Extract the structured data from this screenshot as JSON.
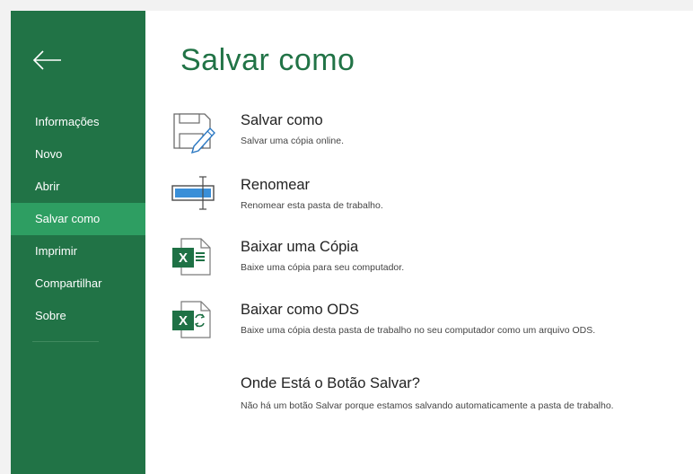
{
  "sidebar": {
    "items": [
      {
        "label": "Informações"
      },
      {
        "label": "Novo"
      },
      {
        "label": "Abrir"
      },
      {
        "label": "Salvar como"
      },
      {
        "label": "Imprimir"
      },
      {
        "label": "Compartilhar"
      },
      {
        "label": "Sobre"
      }
    ],
    "active_index": 3
  },
  "main": {
    "title": "Salvar como",
    "options": [
      {
        "title": "Salvar como",
        "description": "Salvar uma cópia online.",
        "icon": "save-as-icon"
      },
      {
        "title": "Renomear",
        "description": "Renomear esta pasta de trabalho.",
        "icon": "rename-icon"
      },
      {
        "title": "Baixar uma Cópia",
        "description": "Baixe uma cópia para seu computador.",
        "icon": "excel-download-icon"
      },
      {
        "title": "Baixar como ODS",
        "description": "Baixe uma cópia desta pasta de trabalho no seu computador como um arquivo ODS.",
        "icon": "excel-ods-icon"
      }
    ],
    "info": {
      "title": "Onde Está o Botão Salvar?",
      "body": "Não há um botão Salvar porque estamos salvando automaticamente a pasta de trabalho."
    }
  },
  "colors": {
    "sidebar_bg": "#217346",
    "sidebar_active": "#2e9e62",
    "title": "#217346",
    "excel_green": "#1e7145"
  }
}
